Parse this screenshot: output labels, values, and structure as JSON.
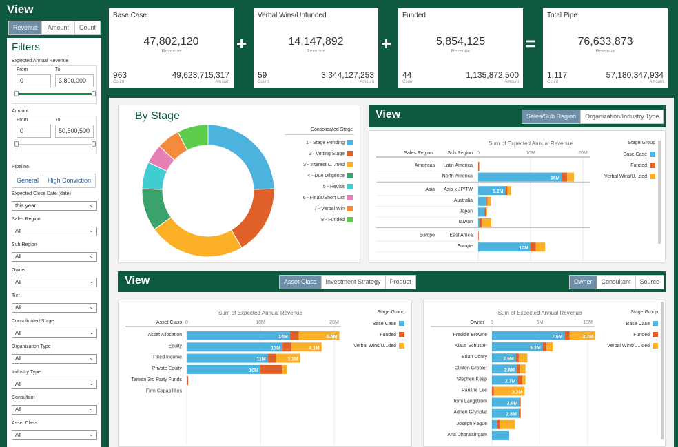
{
  "sidebar": {
    "title": "View",
    "toggle": [
      "Revenue",
      "Amount",
      "Count"
    ],
    "filters_title": "Filters",
    "ear": {
      "label": "Expected Annual Revenue",
      "from_label": "From",
      "to_label": "To",
      "from": "0",
      "to": "3,800,000"
    },
    "amount": {
      "label": "Amount",
      "from_label": "From",
      "to_label": "To",
      "from": "0",
      "to": "50,500,500"
    },
    "pipeline": {
      "label": "Pipeline",
      "options": [
        "General",
        "High Conviction"
      ]
    },
    "selects": [
      {
        "label": "Expected Close Date (date)",
        "value": "this year"
      },
      {
        "label": "Sales Region",
        "value": "All"
      },
      {
        "label": "Sub Region",
        "value": "All"
      },
      {
        "label": "Owner",
        "value": "All"
      },
      {
        "label": "Tier",
        "value": "All"
      },
      {
        "label": "Consolidated Stage",
        "value": "All"
      },
      {
        "label": "Organization Type",
        "value": "All"
      },
      {
        "label": "Industry Type",
        "value": "All"
      },
      {
        "label": "Consultant",
        "value": "All"
      },
      {
        "label": "Asset Class",
        "value": "All"
      }
    ]
  },
  "kpis": [
    {
      "title": "Base Case",
      "value": "47,802,120",
      "sub": "Revenue",
      "count": "963",
      "count_label": "Count",
      "amount": "49,623,715,317",
      "amount_label": "Amount"
    },
    {
      "title": "Verbal Wins/Unfunded",
      "value": "14,147,892",
      "sub": "Revenue",
      "count": "59",
      "count_label": "Count",
      "amount": "3,344,127,253",
      "amount_label": "Amount"
    },
    {
      "title": "Funded",
      "value": "5,854,125",
      "sub": "Revenue",
      "count": "44",
      "count_label": "Count",
      "amount": "1,135,872,500",
      "amount_label": "Amount"
    },
    {
      "title": "Total Pipe",
      "value": "76,633,873",
      "sub": "Revenue",
      "count": "1,117",
      "count_label": "Count",
      "amount": "57,180,347,934",
      "amount_label": "Amount"
    }
  ],
  "operators": [
    "+",
    "+",
    "="
  ],
  "colors": {
    "base": "#4bb3de",
    "funded": "#e0602a",
    "verbal": "#fbb028",
    "green": "#0f5a3f",
    "slate": "#6f8fa8"
  },
  "by_stage": {
    "title": "By Stage",
    "legend_title": "Consolidated Stage",
    "chart_data": {
      "type": "pie",
      "labels": [
        "1 - Stage Pending",
        "2 - Vetting Stage",
        "3 - Interest C...med",
        "4 - Due Diligence",
        "5 - Revisit",
        "6 - Finals/Short List",
        "7 - Verbal Win",
        "8 - Funded"
      ],
      "values": [
        26,
        18,
        25,
        11,
        7,
        5,
        6,
        8
      ],
      "colors": [
        "#4bb3de",
        "#e0602a",
        "#fbb028",
        "#3aa26a",
        "#40ccd0",
        "#e77fb6",
        "#f38a3c",
        "#5ccc4a"
      ]
    }
  },
  "region_view": {
    "title": "View",
    "tabs": [
      "Sales/Sub Region",
      "Organization/Industry Type"
    ],
    "chart_title": "Sum of Expected Annual Revenue",
    "col1": "Sales Region",
    "col2": "Sub Region",
    "legend_title": "Stage Group",
    "legend": [
      "Base Case",
      "Funded",
      "Verbal Wins/U...ded"
    ],
    "chart_data": {
      "type": "bar",
      "orientation": "horizontal-stacked",
      "ticks": [
        "0",
        "10M",
        "20M"
      ],
      "xlim": [
        0,
        20
      ],
      "rows": [
        {
          "region": "Americas",
          "sub": "Latin America",
          "values": [
            0,
            0.2,
            0
          ]
        },
        {
          "region": "",
          "sub": "North America",
          "values": [
            16,
            1,
            1.3
          ],
          "label": "16M"
        },
        {
          "region": "Asia",
          "sub": "Asia x JP/TW",
          "values": [
            5.2,
            0.4,
            0.7
          ],
          "label": "5.2M"
        },
        {
          "region": "",
          "sub": "Australia",
          "values": [
            1.6,
            0.2,
            0.6
          ]
        },
        {
          "region": "",
          "sub": "Japan",
          "values": [
            1.2,
            0.3,
            0.2
          ]
        },
        {
          "region": "",
          "sub": "Taiwan",
          "values": [
            0.3,
            0.4,
            1.8
          ]
        },
        {
          "region": "Europe",
          "sub": "East Africa",
          "values": [
            0,
            0.1,
            0
          ]
        },
        {
          "region": "",
          "sub": "Europe",
          "values": [
            10,
            1,
            1.8
          ],
          "label": "10M"
        }
      ]
    }
  },
  "bottom_view": {
    "title": "View",
    "tabs_left": [
      "Asset Class",
      "Investment Strategy",
      "Product"
    ],
    "tabs_right": [
      "Owner",
      "Consultant",
      "Source"
    ]
  },
  "asset_chart": {
    "chart_title": "Sum of Expected Annual Revenue",
    "col": "Asset Class",
    "legend_title": "Stage Group",
    "legend": [
      "Base Case",
      "Funded",
      "Verbal Wins/U...ded"
    ],
    "chart_data": {
      "type": "bar",
      "orientation": "horizontal-stacked",
      "ticks": [
        "0",
        "10M",
        "20M"
      ],
      "xlim": [
        0,
        20
      ],
      "rows": [
        {
          "name": "Asset Allocation",
          "values": [
            14,
            1.2,
            5.5
          ],
          "labels": [
            "14M",
            "",
            "5.5M"
          ]
        },
        {
          "name": "Equity",
          "values": [
            13,
            1.2,
            4.1
          ],
          "labels": [
            "13M",
            "",
            "4.1M"
          ]
        },
        {
          "name": "Fixed Income",
          "values": [
            11,
            1.1,
            3.3
          ],
          "labels": [
            "11M",
            "",
            "3.3M"
          ]
        },
        {
          "name": "Private Equity",
          "values": [
            10,
            3,
            0.6
          ],
          "labels": [
            "10M",
            "",
            ""
          ]
        },
        {
          "name": "Taiwan 3rd Party Funds",
          "values": [
            0,
            0.2,
            0
          ],
          "labels": [
            "",
            "",
            ""
          ]
        },
        {
          "name": "Firm Capabilities",
          "values": [
            0,
            0,
            0
          ],
          "labels": [
            "",
            "",
            ""
          ]
        }
      ]
    }
  },
  "owner_chart": {
    "chart_title": "Sum of Expected Annual Revenue",
    "col": "Owner",
    "legend_title": "Stage Group",
    "legend": [
      "Base Case",
      "Funded",
      "Verbal Wins/U...ded"
    ],
    "chart_data": {
      "type": "bar",
      "orientation": "horizontal-stacked",
      "ticks": [
        "0",
        "5M",
        "10M"
      ],
      "xlim": [
        0,
        10
      ],
      "rows": [
        {
          "name": "Freddie Browne",
          "values": [
            7.6,
            0.5,
            2.7
          ],
          "labels": [
            "7.6M",
            "",
            "2.7M"
          ]
        },
        {
          "name": "Klaus Schuster",
          "values": [
            5.3,
            0.4,
            0.7
          ],
          "labels": [
            "5.3M",
            "",
            ""
          ]
        },
        {
          "name": "Brian Conry",
          "values": [
            2.5,
            0.3,
            0.9
          ],
          "labels": [
            "2.5M",
            "",
            ""
          ]
        },
        {
          "name": "Clinton Grobler",
          "values": [
            2.6,
            0.3,
            0.6
          ],
          "labels": [
            "2.6M",
            "",
            ""
          ]
        },
        {
          "name": "Stephen Keep",
          "values": [
            2.7,
            0.4,
            0.4
          ],
          "labels": [
            "2.7M",
            "",
            ""
          ]
        },
        {
          "name": "Pauline Lee",
          "values": [
            0,
            0.2,
            3.2
          ],
          "labels": [
            "",
            "",
            "3.2M"
          ]
        },
        {
          "name": "Tomi Langstrom",
          "values": [
            2.9,
            0.1,
            0
          ],
          "labels": [
            "2.9M",
            "",
            ""
          ]
        },
        {
          "name": "Adrien Grynblat",
          "values": [
            2.8,
            0.2,
            0
          ],
          "labels": [
            "2.8M",
            "",
            ""
          ]
        },
        {
          "name": "Joseph Fague",
          "values": [
            0.5,
            0.3,
            1.6
          ],
          "labels": [
            "",
            "",
            ""
          ]
        },
        {
          "name": "Ana Dhoraisingam",
          "values": [
            1.8,
            0,
            0
          ],
          "labels": [
            "",
            "",
            ""
          ]
        }
      ]
    }
  }
}
